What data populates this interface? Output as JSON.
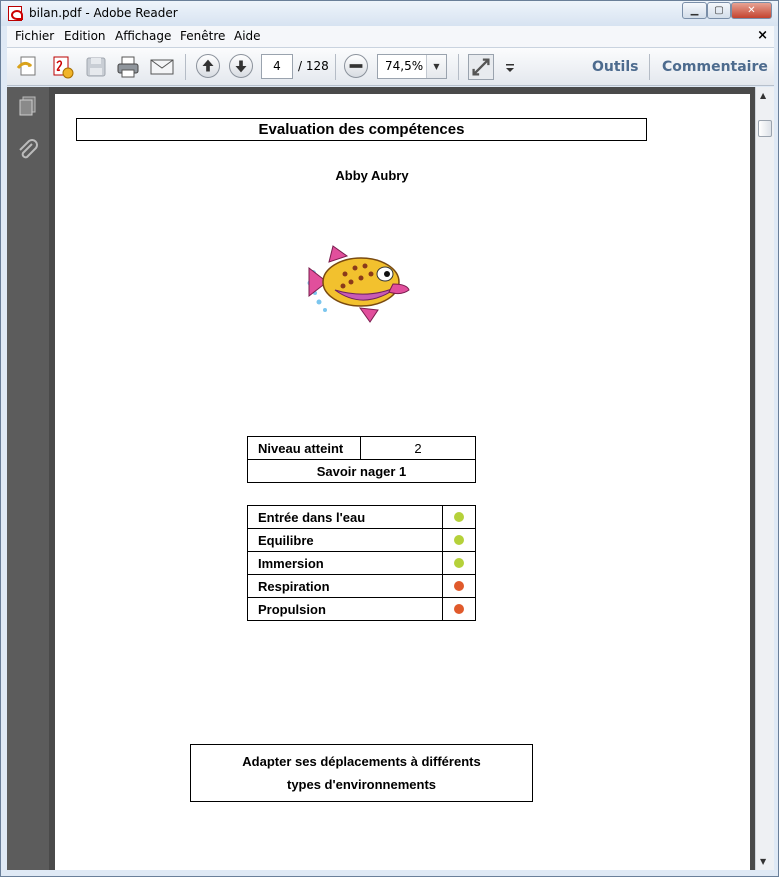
{
  "window": {
    "title": "bilan.pdf - Adobe Reader"
  },
  "menu": {
    "items": [
      "Fichier",
      "Edition",
      "Affichage",
      "Fenêtre",
      "Aide"
    ],
    "close": "×"
  },
  "toolbar": {
    "page_current": "4",
    "page_total": "/ 128",
    "zoom": "74,5%",
    "tools_label": "Outils",
    "comment_label": "Commentaire",
    "icons": [
      "create-pdf-icon",
      "review-icon",
      "save-icon",
      "print-icon",
      "email-icon",
      "prev-page-icon",
      "next-page-icon",
      "zoom-out-icon",
      "fullscreen-icon",
      "more-icon"
    ]
  },
  "left_panel": {
    "icons": [
      "pages-icon",
      "attachment-icon"
    ]
  },
  "document": {
    "title": "Evaluation des compétences",
    "student_name": "Abby Aubry",
    "level_label": "Niveau atteint",
    "level_value": "2",
    "level_name": "Savoir nager 1",
    "skills": [
      {
        "name": "Entrée dans l'eau",
        "status_color": "#b5d13a"
      },
      {
        "name": "Equilibre",
        "status_color": "#b5d13a"
      },
      {
        "name": "Immersion",
        "status_color": "#b5d13a"
      },
      {
        "name": "Respiration",
        "status_color": "#e05a2b"
      },
      {
        "name": "Propulsion",
        "status_color": "#e05a2b"
      }
    ],
    "objective_line1": "Adapter ses déplacements à différents",
    "objective_line2": "types d'environnements"
  }
}
